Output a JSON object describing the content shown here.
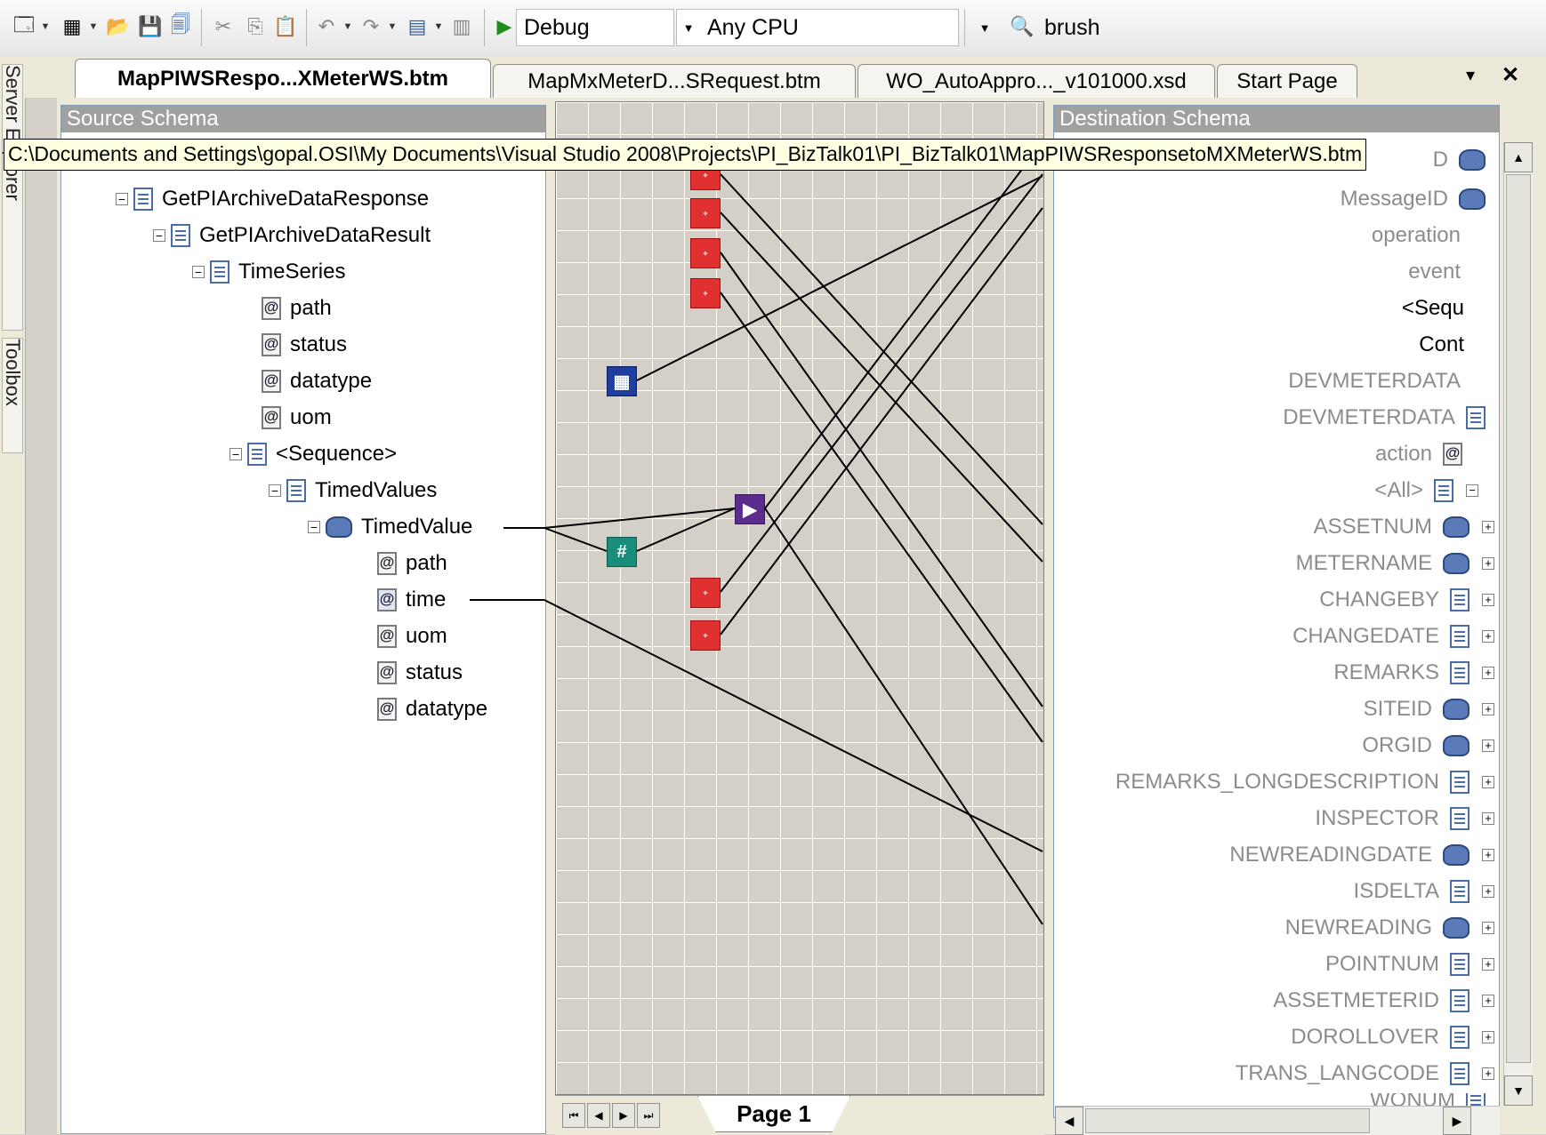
{
  "toolbar": {
    "config_value": "Debug",
    "platform_value": "Any CPU",
    "find_value": "brush"
  },
  "side_tabs": {
    "server_explorer": "Server Explorer",
    "toolbox": "Toolbox"
  },
  "tabs": [
    {
      "label": "MapPIWSRespo...XMeterWS.btm",
      "active": true
    },
    {
      "label": "MapMxMeterD...SRequest.btm",
      "active": false
    },
    {
      "label": "WO_AutoAppro..._v101000.xsd",
      "active": false
    },
    {
      "label": "Start Page",
      "active": false
    }
  ],
  "tab_controls": {
    "dropdown": "▾",
    "close": "✕"
  },
  "source": {
    "header": "Source Schema",
    "nodes": [
      {
        "label": "GetPIArchiveDataResponse"
      },
      {
        "label": "GetPIArchiveDataResult"
      },
      {
        "label": "TimeSeries"
      },
      {
        "label": "path"
      },
      {
        "label": "status"
      },
      {
        "label": "datatype"
      },
      {
        "label": "uom"
      },
      {
        "label": "<Sequence>"
      },
      {
        "label": "TimedValues"
      },
      {
        "label": "TimedValue"
      },
      {
        "label": "path"
      },
      {
        "label": "time"
      },
      {
        "label": "uom"
      },
      {
        "label": "status"
      },
      {
        "label": "datatype"
      }
    ]
  },
  "tooltip": "C:\\Documents and Settings\\gopal.OSI\\My Documents\\Visual Studio 2008\\Projects\\PI_BizTalk01\\PI_BizTalk01\\MapPIWSResponsetoMXMeterWS.btm",
  "dest": {
    "header": "Destination Schema",
    "nodes": [
      {
        "label": "D"
      },
      {
        "label": "MessageID"
      },
      {
        "label": "operation"
      },
      {
        "label": "event"
      },
      {
        "label": "<Sequ"
      },
      {
        "label": "Cont"
      },
      {
        "label": "DEVMETERDATA"
      },
      {
        "label": "DEVMETERDATA"
      },
      {
        "label": "action"
      },
      {
        "label": "<All>"
      },
      {
        "label": "ASSETNUM"
      },
      {
        "label": "METERNAME"
      },
      {
        "label": "CHANGEBY"
      },
      {
        "label": "CHANGEDATE"
      },
      {
        "label": "REMARKS"
      },
      {
        "label": "SITEID"
      },
      {
        "label": "ORGID"
      },
      {
        "label": "REMARKS_LONGDESCRIPTION"
      },
      {
        "label": "INSPECTOR"
      },
      {
        "label": "NEWREADINGDATE"
      },
      {
        "label": "ISDELTA"
      },
      {
        "label": "NEWREADING"
      },
      {
        "label": "POINTNUM"
      },
      {
        "label": "ASSETMETERID"
      },
      {
        "label": "DOROLLOVER"
      },
      {
        "label": "TRANS_LANGCODE"
      },
      {
        "label": "WONUM"
      }
    ]
  },
  "grid": {
    "page_tab": "Page 1"
  },
  "functoids": {
    "count_glyph": "#"
  }
}
